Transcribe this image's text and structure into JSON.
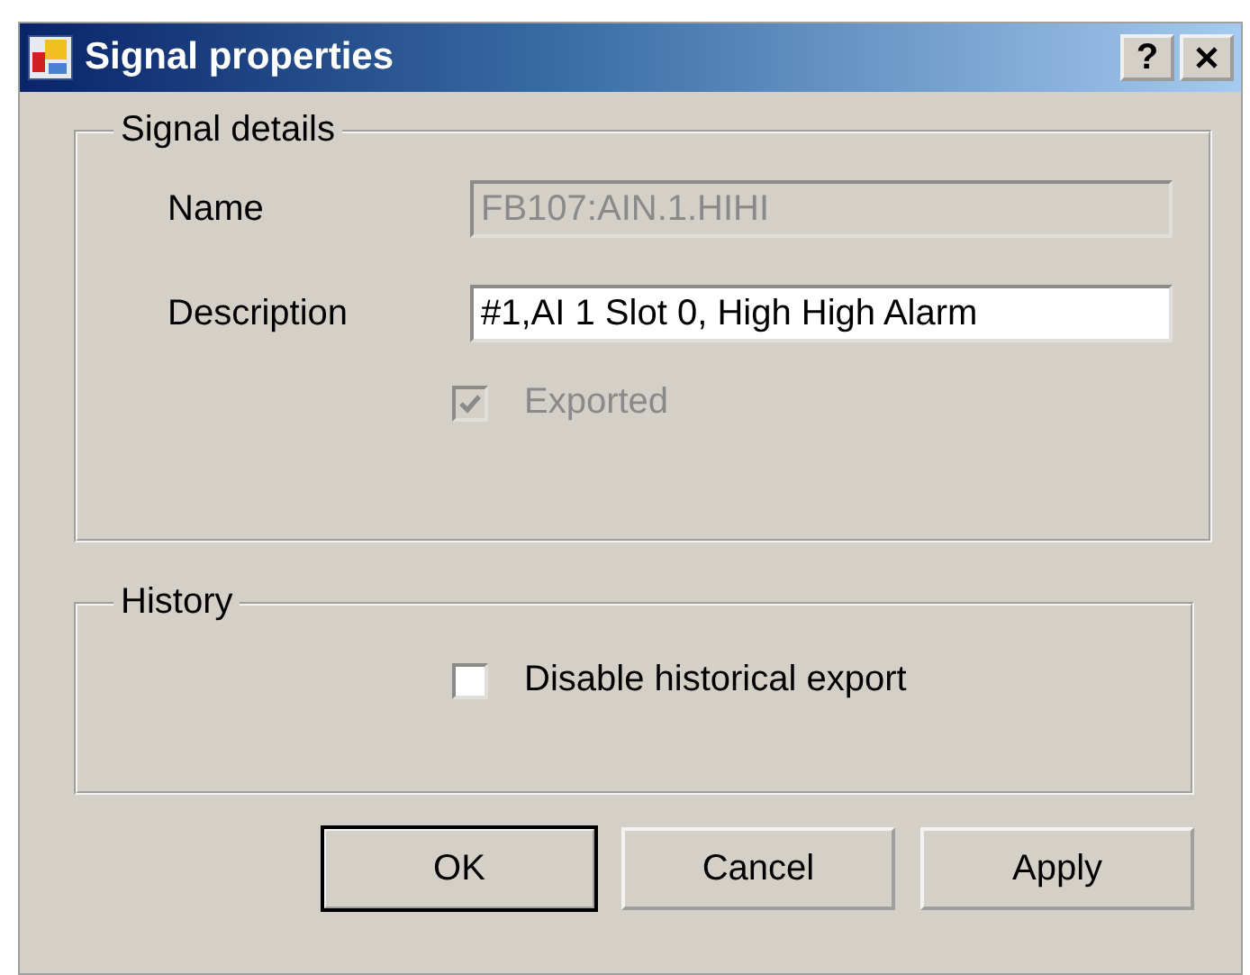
{
  "window": {
    "title": "Signal properties",
    "help_label": "?"
  },
  "signal_details": {
    "title": "Signal details",
    "fields": [
      {
        "label": "Name",
        "value": "FB107:AIN.1.HIHI",
        "disabled": true
      },
      {
        "label": "Description",
        "value": "#1,AI 1 Slot 0, High High Alarm",
        "disabled": false
      }
    ],
    "checkbox": {
      "label": "Exported",
      "checked": true,
      "disabled": true
    }
  },
  "history": {
    "title": "History",
    "checkbox": {
      "label": "Disable historical export",
      "checked": false,
      "disabled": false
    }
  },
  "buttons": [
    {
      "label": "OK",
      "default": true
    },
    {
      "label": "Cancel",
      "default": false
    },
    {
      "label": "Apply",
      "default": false
    }
  ]
}
